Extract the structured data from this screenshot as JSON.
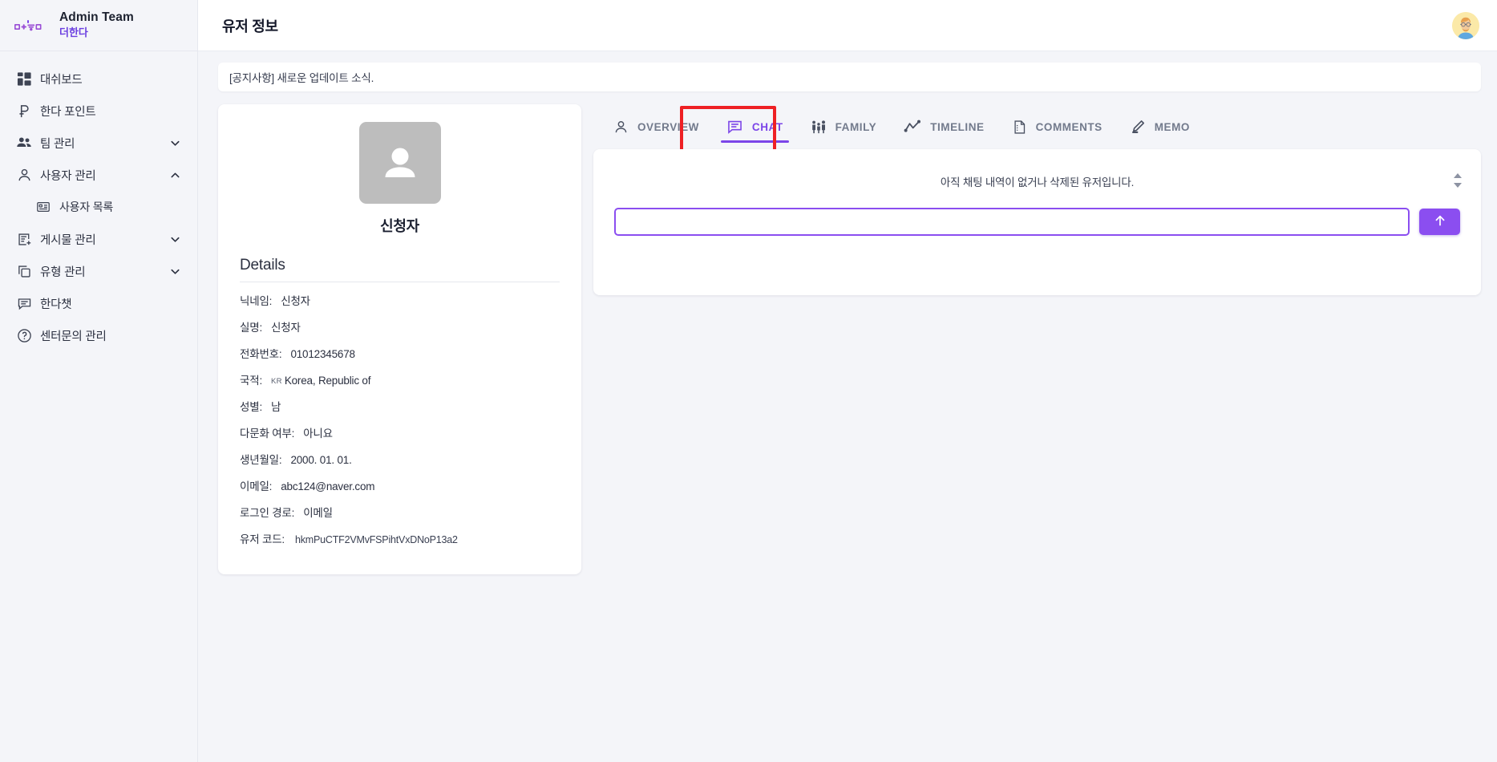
{
  "brand": {
    "name": "Admin Team",
    "subtitle": "더한다",
    "logo_icon": "더한다-logo-icon"
  },
  "sidebar": {
    "items": [
      {
        "label": "대쉬보드",
        "icon": "dashboard-icon",
        "expandable": false,
        "expanded": false,
        "sub": false
      },
      {
        "label": "한다 포인트",
        "icon": "point-icon",
        "expandable": false,
        "expanded": false,
        "sub": false
      },
      {
        "label": "팀 관리",
        "icon": "people-icon",
        "expandable": true,
        "expanded": false,
        "sub": false
      },
      {
        "label": "사용자 관리",
        "icon": "person-icon",
        "expandable": true,
        "expanded": true,
        "sub": false
      },
      {
        "label": "사용자 목록",
        "icon": "list-card-icon",
        "expandable": false,
        "expanded": false,
        "sub": true
      },
      {
        "label": "게시물 관리",
        "icon": "post-add-icon",
        "expandable": true,
        "expanded": false,
        "sub": false
      },
      {
        "label": "유형 관리",
        "icon": "copy-icon",
        "expandable": true,
        "expanded": false,
        "sub": false
      },
      {
        "label": "한다챗",
        "icon": "chat-bubble-icon",
        "expandable": false,
        "expanded": false,
        "sub": false
      },
      {
        "label": "센터문의 관리",
        "icon": "help-circle-icon",
        "expandable": false,
        "expanded": false,
        "sub": false
      }
    ]
  },
  "header": {
    "title": "유저 정보",
    "avatar_icon": "user-avatar"
  },
  "notice": {
    "text": "[공지사항] 새로운 업데이트 소식."
  },
  "profile": {
    "photo_icon": "person-placeholder-icon",
    "name": "신청자",
    "details_title": "Details",
    "details": [
      {
        "key": "닉네임:",
        "value": "신청자",
        "flag": ""
      },
      {
        "key": "실명:",
        "value": "신청자",
        "flag": ""
      },
      {
        "key": "전화번호:",
        "value": "01012345678",
        "flag": ""
      },
      {
        "key": "국적:",
        "value": "Korea, Republic of",
        "flag": "KR"
      },
      {
        "key": "성별:",
        "value": "남",
        "flag": ""
      },
      {
        "key": "다문화 여부:",
        "value": "아니요",
        "flag": ""
      },
      {
        "key": "생년월일:",
        "value": "2000. 01. 01.",
        "flag": ""
      },
      {
        "key": "이메일:",
        "value": "abc124@naver.com",
        "flag": ""
      },
      {
        "key": "로그인 경로:",
        "value": "이메일",
        "flag": ""
      },
      {
        "key": "유저 코드:",
        "value": "hkmPuCTF2VMvFSPihtVxDNoP13a2",
        "flag": ""
      }
    ]
  },
  "tabs": [
    {
      "label": "OVERVIEW",
      "icon": "person-outline-icon",
      "active": false
    },
    {
      "label": "CHAT",
      "icon": "chat-bubble-icon",
      "active": true
    },
    {
      "label": "FAMILY",
      "icon": "family-icon",
      "active": false
    },
    {
      "label": "TIMELINE",
      "icon": "trend-line-icon",
      "active": false
    },
    {
      "label": "COMMENTS",
      "icon": "document-icon",
      "active": false
    },
    {
      "label": "MEMO",
      "icon": "pencil-edit-icon",
      "active": false
    }
  ],
  "chat": {
    "empty_message": "아직 채팅 내역이 없거나 삭제된 유저입니다.",
    "input_value": "",
    "input_placeholder": "",
    "send_icon": "arrow-up-icon",
    "scroll_up_icon": "triangle-up-icon",
    "scroll_down_icon": "triangle-down-icon"
  },
  "colors": {
    "accent": "#7b45e8",
    "accent_input_border": "#8b4ef0",
    "highlight_box": "#ee2024",
    "sidebar_bg": "#f4f5f9",
    "content_bg": "#f4f5f9"
  }
}
